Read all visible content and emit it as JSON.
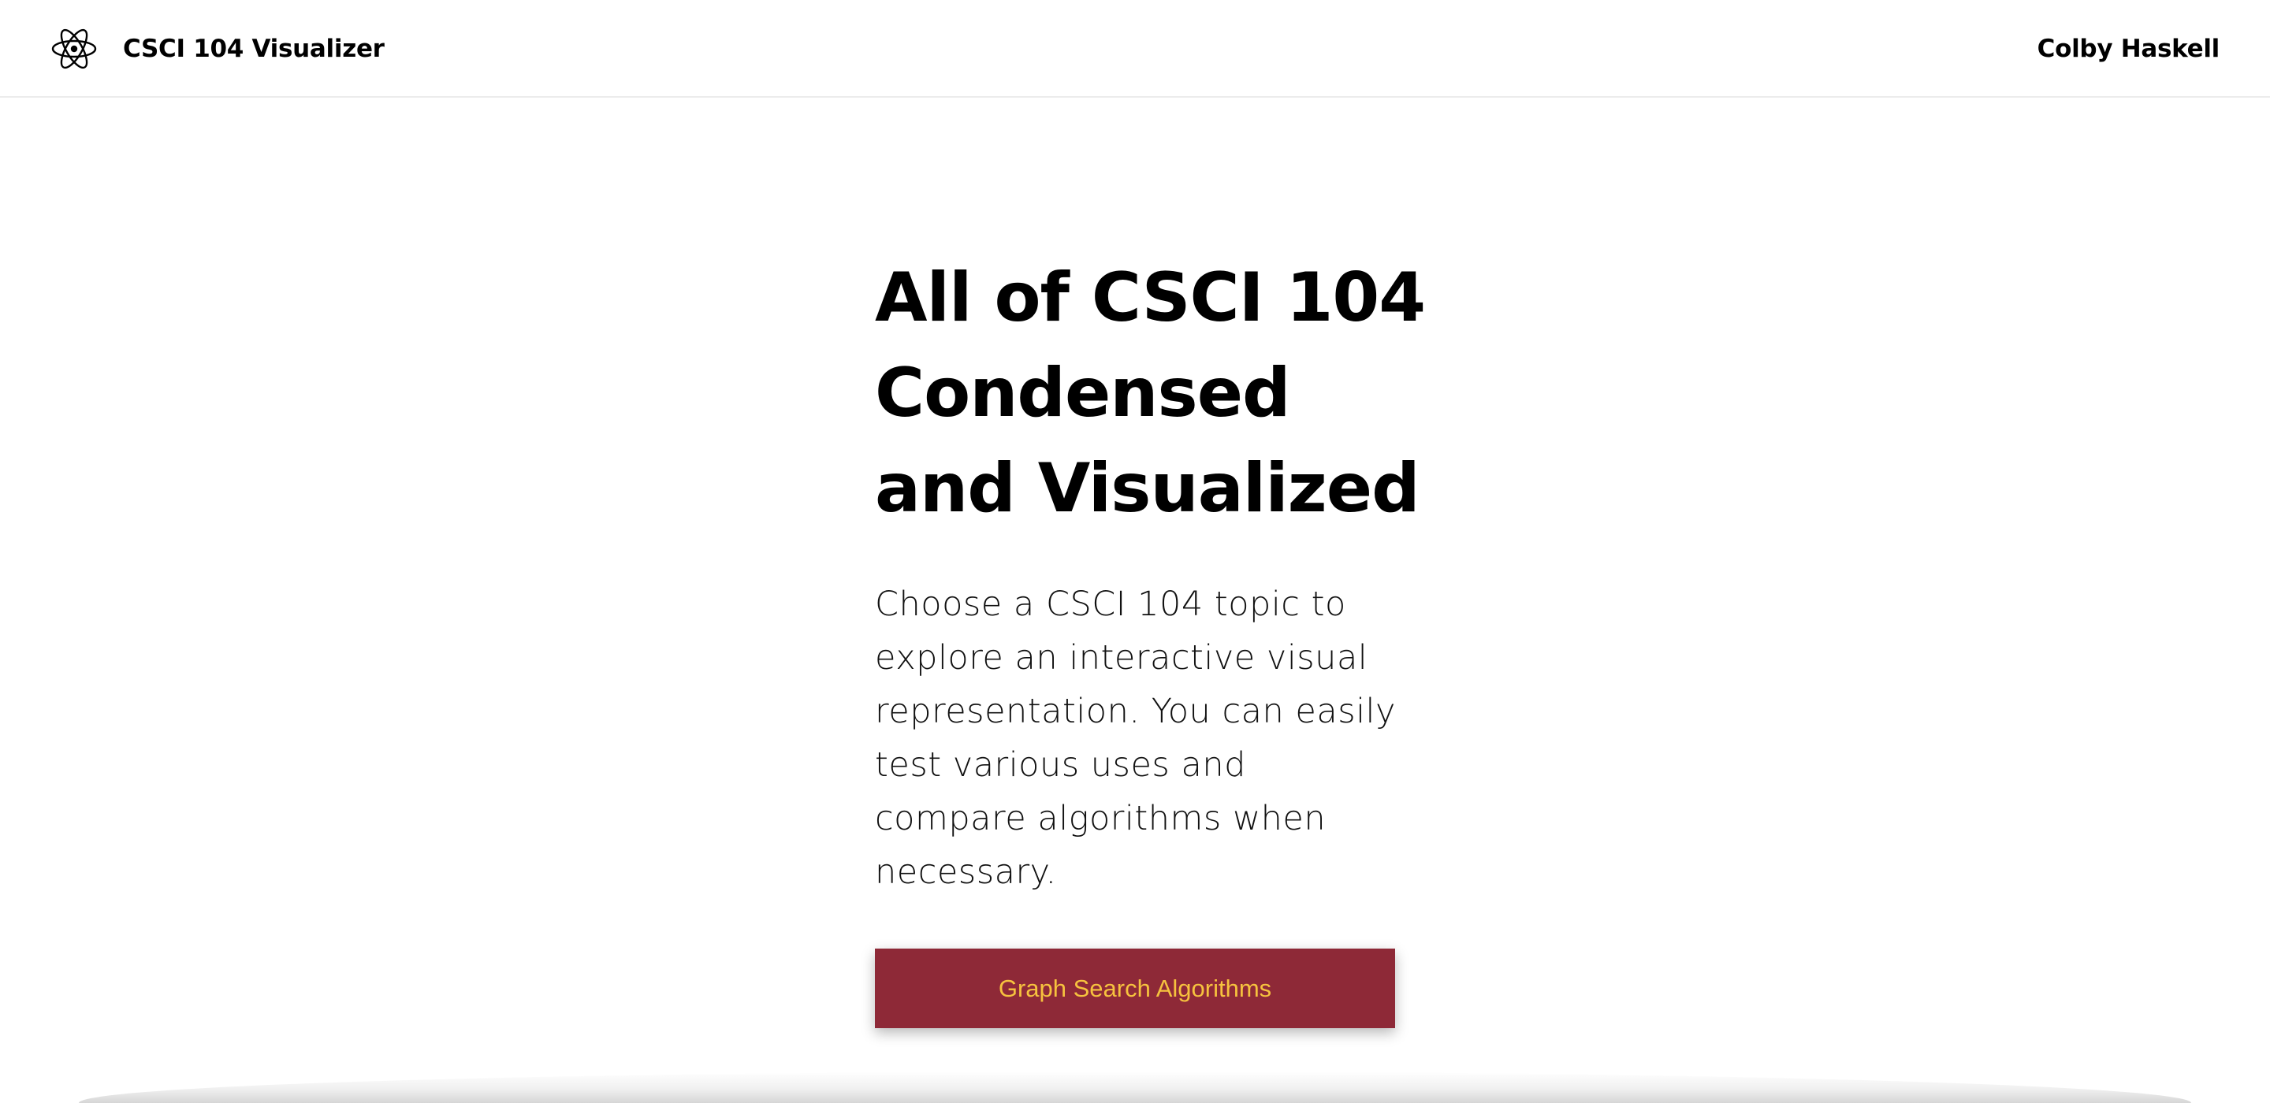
{
  "navbar": {
    "brand_icon": "atom-icon",
    "brand_title": "CSCI 104 Visualizer",
    "author": "Colby Haskell"
  },
  "hero": {
    "title_lines": [
      "All of CSCI 104",
      "Condensed",
      "and Visualized"
    ],
    "description_lines": [
      "Choose a CSCI 104 topic to",
      "explore an interactive visual",
      "representation. You can easily",
      "test various uses and",
      "compare algorithms when",
      "necessary."
    ],
    "cta_label": "Graph Search Algorithms"
  },
  "colors": {
    "cta_background": "#8e2937",
    "cta_text": "#f6c23e",
    "text": "#000000",
    "background": "#ffffff"
  }
}
